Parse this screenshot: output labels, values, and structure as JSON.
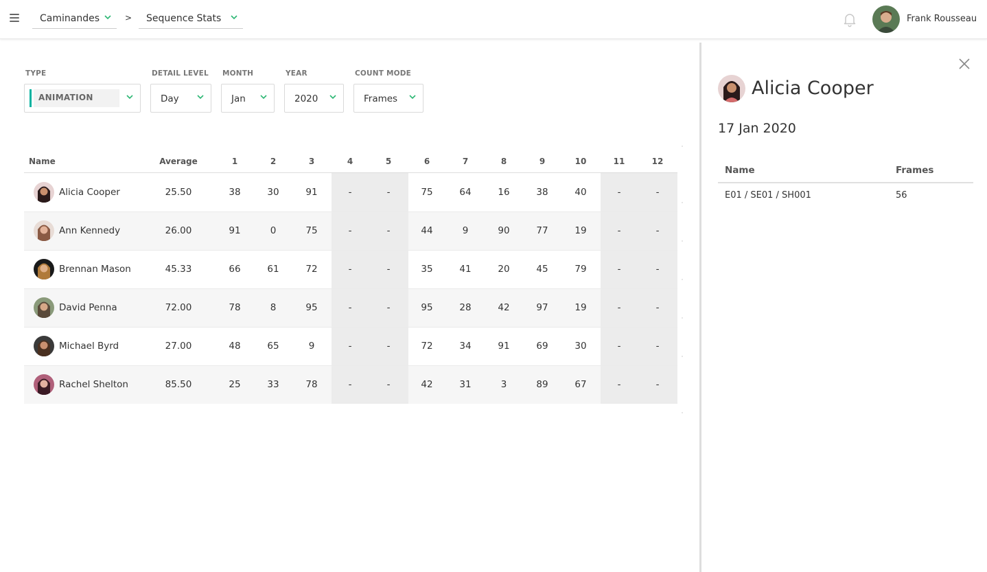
{
  "header": {
    "breadcrumb": {
      "production": "Caminandes",
      "section": "Sequence Stats",
      "separator": ">"
    },
    "user": {
      "name": "Frank Rousseau"
    }
  },
  "filters": {
    "type": {
      "label": "TYPE",
      "value": "ANIMATION"
    },
    "detail_level": {
      "label": "DETAIL LEVEL",
      "value": "Day"
    },
    "month": {
      "label": "MONTH",
      "value": "Jan"
    },
    "year": {
      "label": "YEAR",
      "value": "2020"
    },
    "count_mode": {
      "label": "COUNT MODE",
      "value": "Frames"
    }
  },
  "table": {
    "headers": {
      "name": "Name",
      "average": "Average",
      "days": [
        "1",
        "2",
        "3",
        "4",
        "5",
        "6",
        "7",
        "8",
        "9",
        "10",
        "11",
        "12"
      ]
    },
    "rows": [
      {
        "name": "Alicia Cooper",
        "average": "25.50",
        "days": [
          "38",
          "30",
          "91",
          "-",
          "-",
          "75",
          "64",
          "16",
          "38",
          "40",
          "-",
          "-"
        ]
      },
      {
        "name": "Ann Kennedy",
        "average": "26.00",
        "days": [
          "91",
          "0",
          "75",
          "-",
          "-",
          "44",
          "9",
          "90",
          "77",
          "19",
          "-",
          "-"
        ]
      },
      {
        "name": "Brennan Mason",
        "average": "45.33",
        "days": [
          "66",
          "61",
          "72",
          "-",
          "-",
          "35",
          "41",
          "20",
          "45",
          "79",
          "-",
          "-"
        ]
      },
      {
        "name": "David Penna",
        "average": "72.00",
        "days": [
          "78",
          "8",
          "95",
          "-",
          "-",
          "95",
          "28",
          "42",
          "97",
          "19",
          "-",
          "-"
        ]
      },
      {
        "name": "Michael Byrd",
        "average": "27.00",
        "days": [
          "48",
          "65",
          "9",
          "-",
          "-",
          "72",
          "34",
          "91",
          "69",
          "30",
          "-",
          "-"
        ]
      },
      {
        "name": "Rachel Shelton",
        "average": "85.50",
        "days": [
          "25",
          "33",
          "78",
          "-",
          "-",
          "42",
          "31",
          "3",
          "89",
          "67",
          "-",
          "-"
        ]
      }
    ]
  },
  "side_panel": {
    "person": "Alicia Cooper",
    "date": "17 Jan 2020",
    "columns": {
      "name": "Name",
      "frames": "Frames"
    },
    "entries": [
      {
        "name": "E01 / SE01 / SH001",
        "frames": "56"
      }
    ]
  },
  "colors": {
    "accent": "#00b29f",
    "chevron": "#2bb673"
  },
  "icons": {
    "menu": "hamburger-icon",
    "notifications": "bell-icon",
    "close": "close-icon",
    "dropdown": "chevron-down-icon"
  }
}
